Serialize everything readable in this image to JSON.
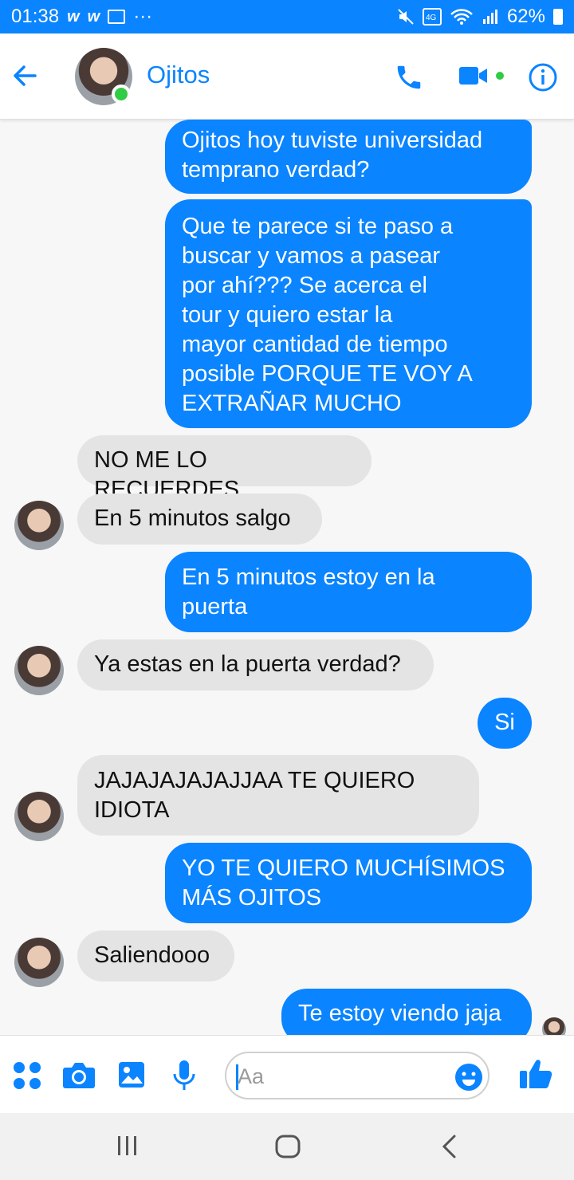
{
  "status": {
    "time": "01:38",
    "battery_percent": "62%",
    "app_glyphs": [
      "w",
      "w"
    ],
    "more": "···"
  },
  "header": {
    "contact_name": "Ojitos"
  },
  "messages": [
    {
      "text": "Ojitos hoy tuviste universidad\ntemprano verdad?",
      "dir": "out"
    },
    {
      "text": "Que te parece si te paso a\nbuscar y vamos a pasear\npor ahí??? Se acerca el\ntour y quiero estar la\nmayor cantidad de tiempo\nposible PORQUE TE VOY A\nEXTRAÑAR MUCHO",
      "dir": "out"
    },
    {
      "text": "NO ME LO RECUERDES",
      "dir": "in"
    },
    {
      "text": "En 5 minutos salgo",
      "dir": "in"
    },
    {
      "text": "En 5 minutos estoy en la\npuerta",
      "dir": "out"
    },
    {
      "text": "Ya estas en la puerta verdad?",
      "dir": "in"
    },
    {
      "text": "Si",
      "dir": "out"
    },
    {
      "text": "JAJAJAJAJAJJAA TE QUIERO\nIDIOTA",
      "dir": "in"
    },
    {
      "text": "YO TE QUIERO MUCHÍSIMOS\nMÁS OJITOS",
      "dir": "out"
    },
    {
      "text": "Saliendooo",
      "dir": "in"
    },
    {
      "text": "Te estoy viendo jaja",
      "dir": "out"
    }
  ],
  "composer": {
    "placeholder": "Aa"
  },
  "colors": {
    "brand": "#0a84ff",
    "online": "#31cc46",
    "incoming_bubble": "#e4e4e4"
  },
  "icons": {
    "header": [
      "back-arrow-icon",
      "phone-icon",
      "video-camera-icon",
      "info-icon"
    ],
    "composer": [
      "apps-grid-icon",
      "camera-icon",
      "image-icon",
      "microphone-icon",
      "emoji-icon",
      "thumbs-up-icon"
    ],
    "nav": [
      "recents-icon",
      "home-icon",
      "back-icon"
    ]
  }
}
